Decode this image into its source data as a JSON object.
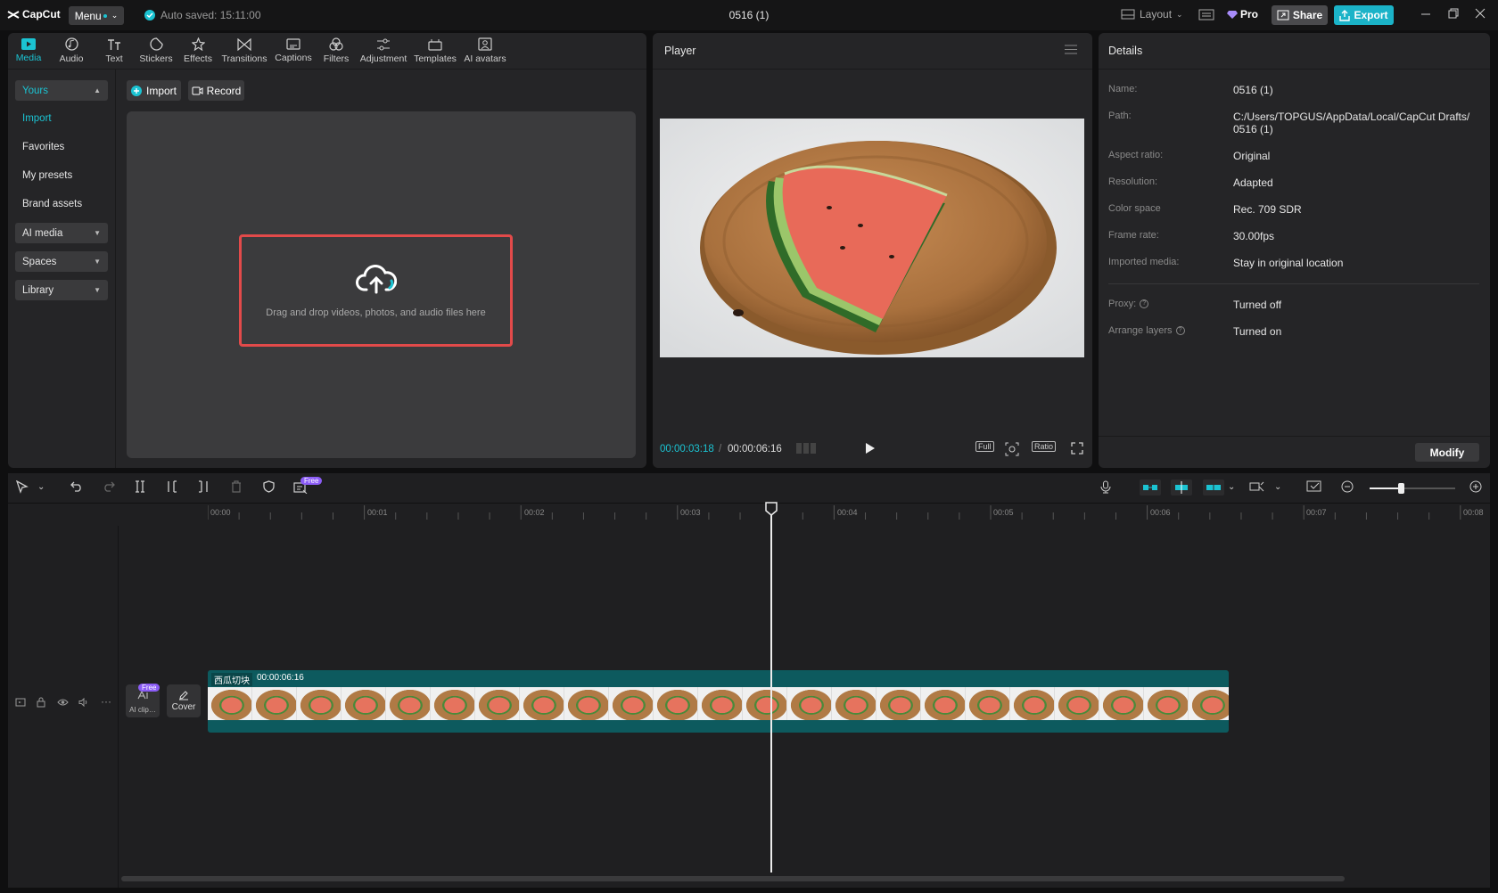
{
  "app": {
    "logo_text": "CapCut",
    "menu_label": "Menu",
    "autosave_text": "Auto saved: 15:11:00",
    "project_title": "0516 (1)",
    "layout_label": "Layout",
    "pro_label": "Pro",
    "share_label": "Share",
    "export_label": "Export",
    "accent_color": "#1bc3d2"
  },
  "tooltabs": [
    {
      "label": "Media",
      "icon": "media-icon"
    },
    {
      "label": "Audio",
      "icon": "audio-icon"
    },
    {
      "label": "Text",
      "icon": "text-icon"
    },
    {
      "label": "Stickers",
      "icon": "stickers-icon"
    },
    {
      "label": "Effects",
      "icon": "effects-icon"
    },
    {
      "label": "Transitions",
      "icon": "transitions-icon"
    },
    {
      "label": "Captions",
      "icon": "captions-icon"
    },
    {
      "label": "Filters",
      "icon": "filters-icon"
    },
    {
      "label": "Adjustment",
      "icon": "adjustment-icon"
    },
    {
      "label": "Templates",
      "icon": "templates-icon"
    },
    {
      "label": "AI avatars",
      "icon": "ai-avatars-icon"
    }
  ],
  "sidebar": {
    "yours": "Yours",
    "import": "Import",
    "favorites": "Favorites",
    "my_presets": "My presets",
    "brand_assets": "Brand assets",
    "ai_media": "AI media",
    "spaces": "Spaces",
    "library": "Library"
  },
  "media": {
    "import_label": "Import",
    "record_label": "Record",
    "drop_text": "Drag and drop videos, photos, and audio files here"
  },
  "player": {
    "title": "Player",
    "current_time": "00:00:03:18",
    "separator": "/",
    "total_time": "00:00:06:16",
    "full_label": "Full",
    "ratio_label": "Ratio"
  },
  "details": {
    "title": "Details",
    "rows": [
      {
        "label": "Name:",
        "value": "0516 (1)"
      },
      {
        "label": "Path:",
        "value": "C:/Users/TOPGUS/AppData/Local/CapCut Drafts/ 0516 (1)"
      },
      {
        "label": "Aspect ratio:",
        "value": "Original"
      },
      {
        "label": "Resolution:",
        "value": "Adapted"
      },
      {
        "label": "Color space",
        "value": "Rec. 709 SDR"
      },
      {
        "label": "Frame rate:",
        "value": "30.00fps"
      },
      {
        "label": "Imported media:",
        "value": "Stay in original location"
      }
    ],
    "proxy_label": "Proxy:",
    "proxy_value": "Turned off",
    "arrange_label": "Arrange layers",
    "arrange_value": "Turned on",
    "modify_label": "Modify"
  },
  "timeline": {
    "free_badge": "Free",
    "ticks": [
      "00:00",
      "00:01",
      "00:02",
      "00:03",
      "00:04",
      "00:05",
      "00:06",
      "00:07",
      "00:08"
    ],
    "clip_name": "西瓜切块",
    "clip_duration": "00:00:06:16",
    "ai_clip_label": "AI clip…",
    "cover_label": "Cover"
  }
}
